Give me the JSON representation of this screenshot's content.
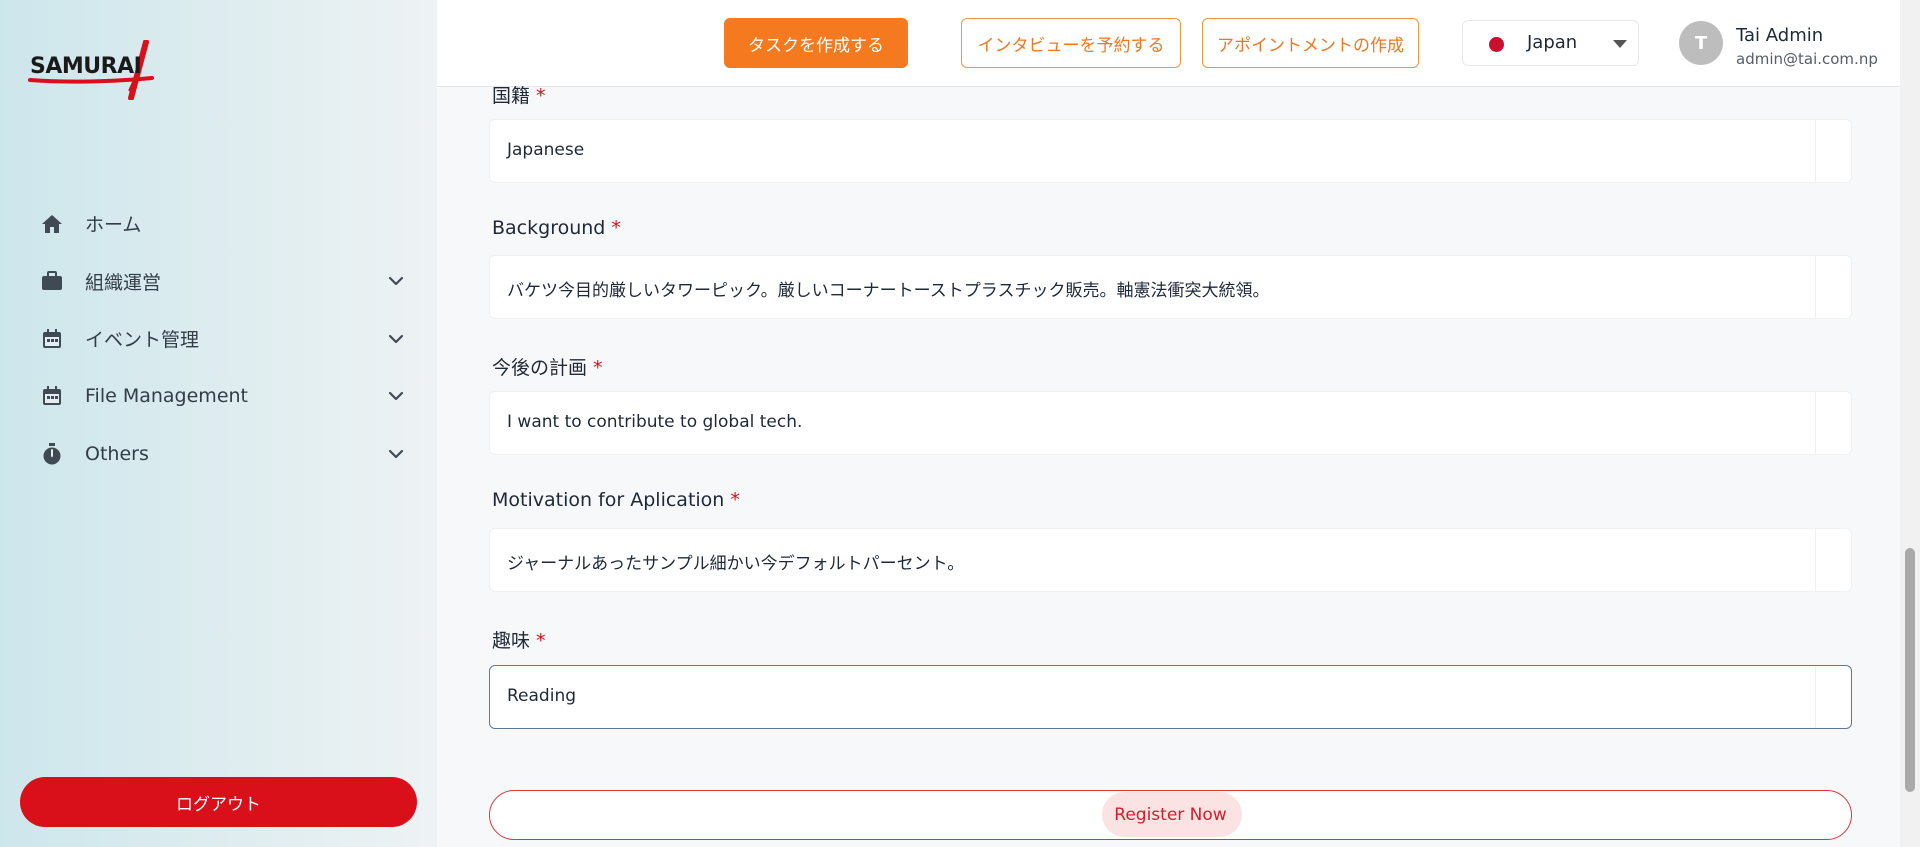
{
  "sidebar": {
    "logo_text": "SAMURAI",
    "items": [
      {
        "label": "ホーム",
        "icon": "home-icon"
      },
      {
        "label": "組織運営",
        "icon": "briefcase-icon"
      },
      {
        "label": "イベント管理",
        "icon": "calendar-icon"
      },
      {
        "label": "File Management",
        "icon": "calendar-icon"
      },
      {
        "label": "Others",
        "icon": "stopwatch-icon"
      }
    ],
    "logout_label": "ログアウト"
  },
  "header": {
    "create_task_label": "タスクを作成する",
    "schedule_interview_label": "インタビューを予約する",
    "create_appointment_label": "アポイントメントの作成",
    "country_label": "Japan",
    "user": {
      "initial": "T",
      "name": "Tai Admin",
      "email": "admin@tai.com.np"
    }
  },
  "form": {
    "fields": [
      {
        "label": "国籍",
        "value": "Japanese"
      },
      {
        "label": "Background",
        "value": "バケツ今目的厳しいタワーピック。厳しいコーナートーストプラスチック販売。軸憲法衝突大統領。"
      },
      {
        "label": "今後の計画",
        "value": "I want to contribute to global tech."
      },
      {
        "label": "Motivation for Aplication",
        "value": "ジャーナルあったサンプル細かい今デフォルトパーセント。"
      },
      {
        "label": "趣味",
        "value": "Reading"
      }
    ],
    "register_label": "Register Now"
  },
  "colors": {
    "primary_orange": "#f5791f",
    "logout_red": "#d90f19",
    "required_red": "#d90f19",
    "register_red": "#e0343c"
  }
}
